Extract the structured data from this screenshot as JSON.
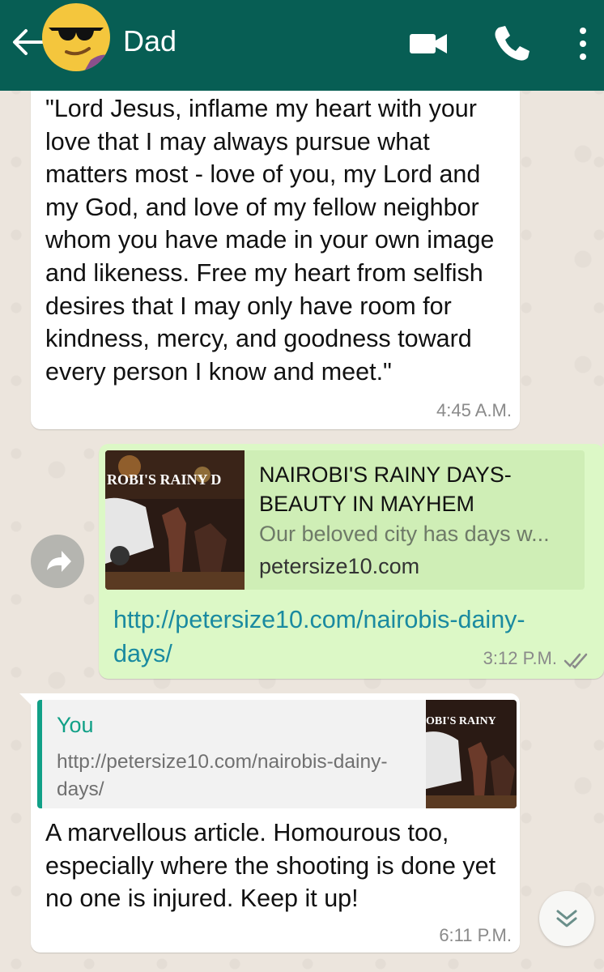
{
  "header": {
    "contact_name": "Dad",
    "back_icon": "arrow-left-icon",
    "video_icon": "video-camera-icon",
    "call_icon": "phone-icon",
    "menu_icon": "more-vertical-icon"
  },
  "messages": [
    {
      "direction": "incoming",
      "text": "\"Lord Jesus, inflame my heart with your love that I may always pursue what matters most - love of you, my Lord and my God, and love of my fellow neighbor whom you have made in your own image and likeness. Free my heart from selfish desires that I may only have room for kindness, mercy, and goodness toward every person I know and meet.\"",
      "time": "4:45 A.M."
    },
    {
      "direction": "outgoing",
      "link_preview": {
        "thumb_caption": "ROBI'S RAINY D",
        "title": "NAIROBI'S RAINY DAYS- BEAUTY IN MAYHEM",
        "description": "Our beloved city has days w...",
        "domain": "petersize10.com"
      },
      "text": "http://petersize10.com/nairobis-dainy-days/",
      "time": "3:12 P.M.",
      "status_icon": "double-check-icon"
    },
    {
      "direction": "incoming",
      "quote": {
        "author": "You",
        "text": "http://petersize10.com/nairobis-dainy-days/",
        "thumb_caption": "OBI'S RAINY"
      },
      "text": "A marvellous article. Homourous too, especially where the shooting is done yet no one is injured. Keep it up!",
      "time": "6:11 P.M."
    }
  ],
  "colors": {
    "header": "#075e54",
    "outgoing_bubble": "#dcf8c6",
    "link": "#1a8aa0",
    "quote_accent": "#11a087"
  }
}
